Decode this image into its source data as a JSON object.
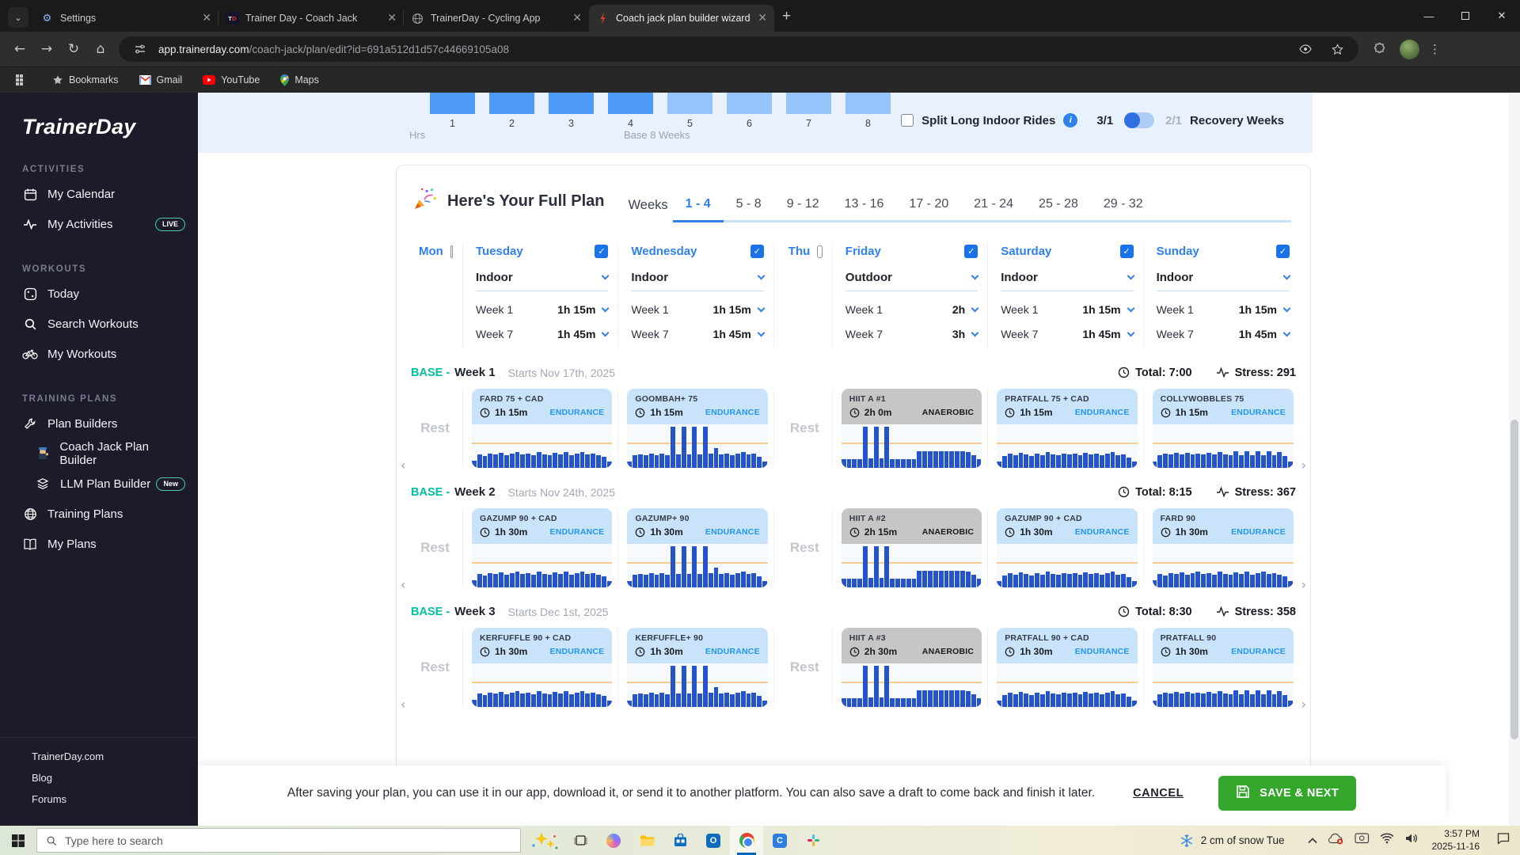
{
  "browser": {
    "tabs": [
      {
        "title": "Settings",
        "icon": "gear",
        "active": false
      },
      {
        "title": "Trainer Day - Coach Jack",
        "icon": "td",
        "active": false
      },
      {
        "title": "TrainerDay - Cycling App",
        "icon": "globe-gray",
        "active": false
      },
      {
        "title": "Coach jack plan builder wizard",
        "icon": "red-mark",
        "active": true
      }
    ],
    "url_host": "app.trainerday.com",
    "url_path": "/coach-jack/plan/edit?id=691a512d1d57c44669105a08",
    "bookmarks": [
      {
        "label": "Bookmarks",
        "icon": "star-gray"
      },
      {
        "label": "Gmail",
        "icon": "gmail"
      },
      {
        "label": "YouTube",
        "icon": "youtube"
      },
      {
        "label": "Maps",
        "icon": "maps"
      }
    ]
  },
  "sidebar": {
    "logo": "TrainerDay",
    "sections": [
      {
        "title": "ACTIVITIES",
        "items": [
          {
            "label": "My Calendar",
            "icon": "calendar"
          },
          {
            "label": "My Activities",
            "icon": "pulse",
            "badge": "LIVE"
          }
        ]
      },
      {
        "title": "WORKOUTS",
        "items": [
          {
            "label": "Today",
            "icon": "today"
          },
          {
            "label": "Search Workouts",
            "icon": "search"
          },
          {
            "label": "My Workouts",
            "icon": "bike"
          }
        ]
      },
      {
        "title": "TRAINING PLANS",
        "items": [
          {
            "label": "Plan Builders",
            "icon": "wrench"
          },
          {
            "label": "Coach Jack Plan Builder",
            "icon": "coach",
            "indent": true
          },
          {
            "label": "LLM Plan Builder",
            "icon": "layers",
            "indent": true,
            "badge": "New"
          },
          {
            "label": "Training Plans",
            "icon": "globe"
          },
          {
            "label": "My Plans",
            "icon": "book"
          }
        ]
      }
    ],
    "footer": [
      "TrainerDay.com",
      "Blog",
      "Forums"
    ]
  },
  "chart_data": {
    "type": "bar",
    "title": "Weekly hours (top of chart clipped by viewport)",
    "categories": [
      "1",
      "2",
      "3",
      "4",
      "5",
      "6",
      "7",
      "8"
    ],
    "values": [
      1,
      1,
      1,
      1,
      1,
      1,
      1,
      1
    ],
    "xlabel": "Base 8 Weeks",
    "ylabel": "Hrs",
    "color_dark": "#4E9AF9",
    "color_light": "#94C4FA",
    "note": "bars 1-4 darker blue, 5-8 lighter blue; bar tops cut off at top of page"
  },
  "topstrip": {
    "hrs_label": "Hrs",
    "phase_label": "Base 8 Weeks",
    "split_label": "Split Long Indoor Rides",
    "info": "i",
    "ratio_on": "3/1",
    "ratio_off": "2/1",
    "recovery_label": "Recovery Weeks"
  },
  "plan_panel": {
    "title": "Here's Your Full Plan",
    "weeks_label": "Weeks",
    "tabs": [
      "1 - 4",
      "5 - 8",
      "9 - 12",
      "13 - 16",
      "17 - 20",
      "21 - 24",
      "25 - 28",
      "29 - 32"
    ],
    "active_tab": 0,
    "week_row_labels": [
      "Week 1",
      "Week 7"
    ],
    "rest_label": "Rest",
    "days": [
      {
        "name": "Mon",
        "checked": false,
        "narrow": true
      },
      {
        "name": "Tuesday",
        "checked": true,
        "mode": "Indoor",
        "week1": "1h 15m",
        "week7": "1h 45m"
      },
      {
        "name": "Wednesday",
        "checked": true,
        "mode": "Indoor",
        "week1": "1h 15m",
        "week7": "1h 45m"
      },
      {
        "name": "Thu",
        "checked": false,
        "narrow": true
      },
      {
        "name": "Friday",
        "checked": true,
        "mode": "Outdoor",
        "week1": "2h",
        "week7": "3h"
      },
      {
        "name": "Saturday",
        "checked": true,
        "mode": "Indoor",
        "week1": "1h 15m",
        "week7": "1h 45m"
      },
      {
        "name": "Sunday",
        "checked": true,
        "mode": "Indoor",
        "week1": "1h 15m",
        "week7": "1h 45m"
      }
    ],
    "profiles": {
      "endur1": [
        0.16,
        0.3,
        0.27,
        0.33,
        0.3,
        0.34,
        0.29,
        0.33,
        0.36,
        0.3,
        0.33,
        0.28,
        0.35,
        0.31,
        0.29,
        0.34,
        0.3,
        0.35,
        0.29,
        0.33,
        0.35,
        0.3,
        0.33,
        0.29,
        0.25,
        0.15
      ],
      "endur2": [
        0.15,
        0.27,
        0.32,
        0.29,
        0.34,
        0.3,
        0.27,
        0.33,
        0.29,
        0.35,
        0.31,
        0.28,
        0.33,
        0.3,
        0.32,
        0.28,
        0.34,
        0.3,
        0.33,
        0.28,
        0.32,
        0.35,
        0.29,
        0.31,
        0.24,
        0.15
      ],
      "endur3": [
        0.15,
        0.28,
        0.33,
        0.3,
        0.34,
        0.31,
        0.34,
        0.3,
        0.33,
        0.3,
        0.34,
        0.31,
        0.35,
        0.31,
        0.28,
        0.38,
        0.28,
        0.38,
        0.28,
        0.38,
        0.28,
        0.38,
        0.28,
        0.36,
        0.26,
        0.15
      ],
      "spiky": [
        0.15,
        0.28,
        0.31,
        0.28,
        0.33,
        0.29,
        0.32,
        0.29,
        0.92,
        0.3,
        0.92,
        0.3,
        0.92,
        0.31,
        0.92,
        0.33,
        0.44,
        0.3,
        0.33,
        0.29,
        0.33,
        0.35,
        0.3,
        0.32,
        0.25,
        0.15
      ],
      "hiit": [
        0.2,
        0.2,
        0.2,
        0.2,
        0.92,
        0.22,
        0.92,
        0.22,
        0.92,
        0.2,
        0.2,
        0.2,
        0.2,
        0.2,
        0.38,
        0.38,
        0.38,
        0.38,
        0.38,
        0.38,
        0.38,
        0.38,
        0.38,
        0.36,
        0.28,
        0.2
      ]
    },
    "weeks": [
      {
        "phase": "BASE -",
        "name": "Week 1",
        "starts": "Starts Nov 17th, 2025",
        "total": "Total: 7:00",
        "stress": "Stress: 291",
        "cards": [
          {
            "rest": true
          },
          {
            "title": "FARD 75 + CAD",
            "duration": "1h 15m",
            "category": "ENDURANCE",
            "style": "endurance",
            "profile": "endur1"
          },
          {
            "title": "GOOMBAH+ 75",
            "duration": "1h 15m",
            "category": "ENDURANCE",
            "style": "endurance",
            "profile": "spiky"
          },
          {
            "rest": true
          },
          {
            "title": "HIIT A #1",
            "duration": "2h 0m",
            "category": "ANAEROBIC",
            "style": "anaerobic",
            "profile": "hiit"
          },
          {
            "title": "PRATFALL 75 + CAD",
            "duration": "1h 15m",
            "category": "ENDURANCE",
            "style": "endurance",
            "profile": "endur2"
          },
          {
            "title": "COLLYWOBBLES 75",
            "duration": "1h 15m",
            "category": "ENDURANCE",
            "style": "endurance",
            "profile": "endur3"
          }
        ]
      },
      {
        "phase": "BASE -",
        "name": "Week 2",
        "starts": "Starts Nov 24th, 2025",
        "total": "Total: 8:15",
        "stress": "Stress: 367",
        "cards": [
          {
            "rest": true
          },
          {
            "title": "GAZUMP 90 + CAD",
            "duration": "1h 30m",
            "category": "ENDURANCE",
            "style": "endurance",
            "profile": "endur1"
          },
          {
            "title": "GAZUMP+ 90",
            "duration": "1h 30m",
            "category": "ENDURANCE",
            "style": "endurance",
            "profile": "spiky"
          },
          {
            "rest": true
          },
          {
            "title": "HIIT A #2",
            "duration": "2h 15m",
            "category": "ANAEROBIC",
            "style": "anaerobic",
            "profile": "hiit"
          },
          {
            "title": "GAZUMP 90 + CAD",
            "duration": "1h 30m",
            "category": "ENDURANCE",
            "style": "endurance",
            "profile": "endur2"
          },
          {
            "title": "FARD 90",
            "duration": "1h 30m",
            "category": "ENDURANCE",
            "style": "endurance",
            "profile": "endur1"
          }
        ]
      },
      {
        "phase": "BASE -",
        "name": "Week 3",
        "starts": "Starts Dec 1st, 2025",
        "total": "Total: 8:30",
        "stress": "Stress: 358",
        "cards": [
          {
            "rest": true
          },
          {
            "title": "KERFUFFLE 90 + CAD",
            "duration": "1h 30m",
            "category": "ENDURANCE",
            "style": "endurance",
            "profile": "endur1"
          },
          {
            "title": "KERFUFFLE+ 90",
            "duration": "1h 30m",
            "category": "ENDURANCE",
            "style": "endurance",
            "profile": "spiky"
          },
          {
            "rest": true
          },
          {
            "title": "HIIT A #3",
            "duration": "2h 30m",
            "category": "ANAEROBIC",
            "style": "anaerobic",
            "profile": "hiit"
          },
          {
            "title": "PRATFALL 90 + CAD",
            "duration": "1h 30m",
            "category": "ENDURANCE",
            "style": "endurance",
            "profile": "endur2"
          },
          {
            "title": "PRATFALL 90",
            "duration": "1h 30m",
            "category": "ENDURANCE",
            "style": "endurance",
            "profile": "endur3"
          }
        ]
      }
    ]
  },
  "notice": {
    "message": "After saving your plan, you can use it in our app, download it, or send it to another platform. You can also save a draft to come back and finish it later.",
    "cancel_label": "CANCEL",
    "save_label": "SAVE & NEXT"
  },
  "taskbar": {
    "search_placeholder": "Type here to search",
    "weather": "2 cm of snow Tue",
    "time": "3:57 PM",
    "date": "2025-11-16"
  }
}
